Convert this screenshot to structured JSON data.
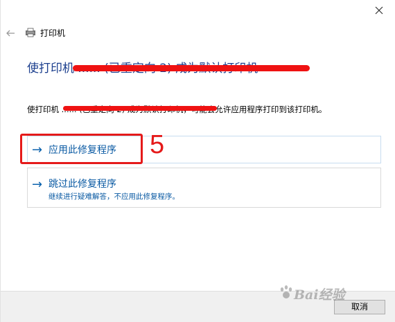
{
  "window": {
    "title": "打印机"
  },
  "heading": {
    "text": "使打印机 ...... (已重定向 2) 成为默认打印机"
  },
  "description": {
    "text": "使打印机 ...... (已重定向 2) 成为默认打印机，可能会允许应用程序打印到该打印机。"
  },
  "options": [
    {
      "arrow": "→",
      "title": "应用此修复程序",
      "subtitle": ""
    },
    {
      "arrow": "→",
      "title": "跳过此修复程序",
      "subtitle": "继续进行疑难解答，不应用此修复程序。"
    }
  ],
  "annotation": {
    "step_number": "5",
    "color": "#e51a1a"
  },
  "footer": {
    "cancel_label": "取消"
  },
  "watermark": {
    "text": "Bai经验"
  },
  "colors": {
    "heading": "#1c3f8e",
    "link": "#0a5aa3",
    "redaction": "#ef1212"
  },
  "icons": {
    "close": "close-icon",
    "back": "back-arrow-icon",
    "printer": "printer-icon",
    "option_arrow": "right-arrow-icon"
  }
}
